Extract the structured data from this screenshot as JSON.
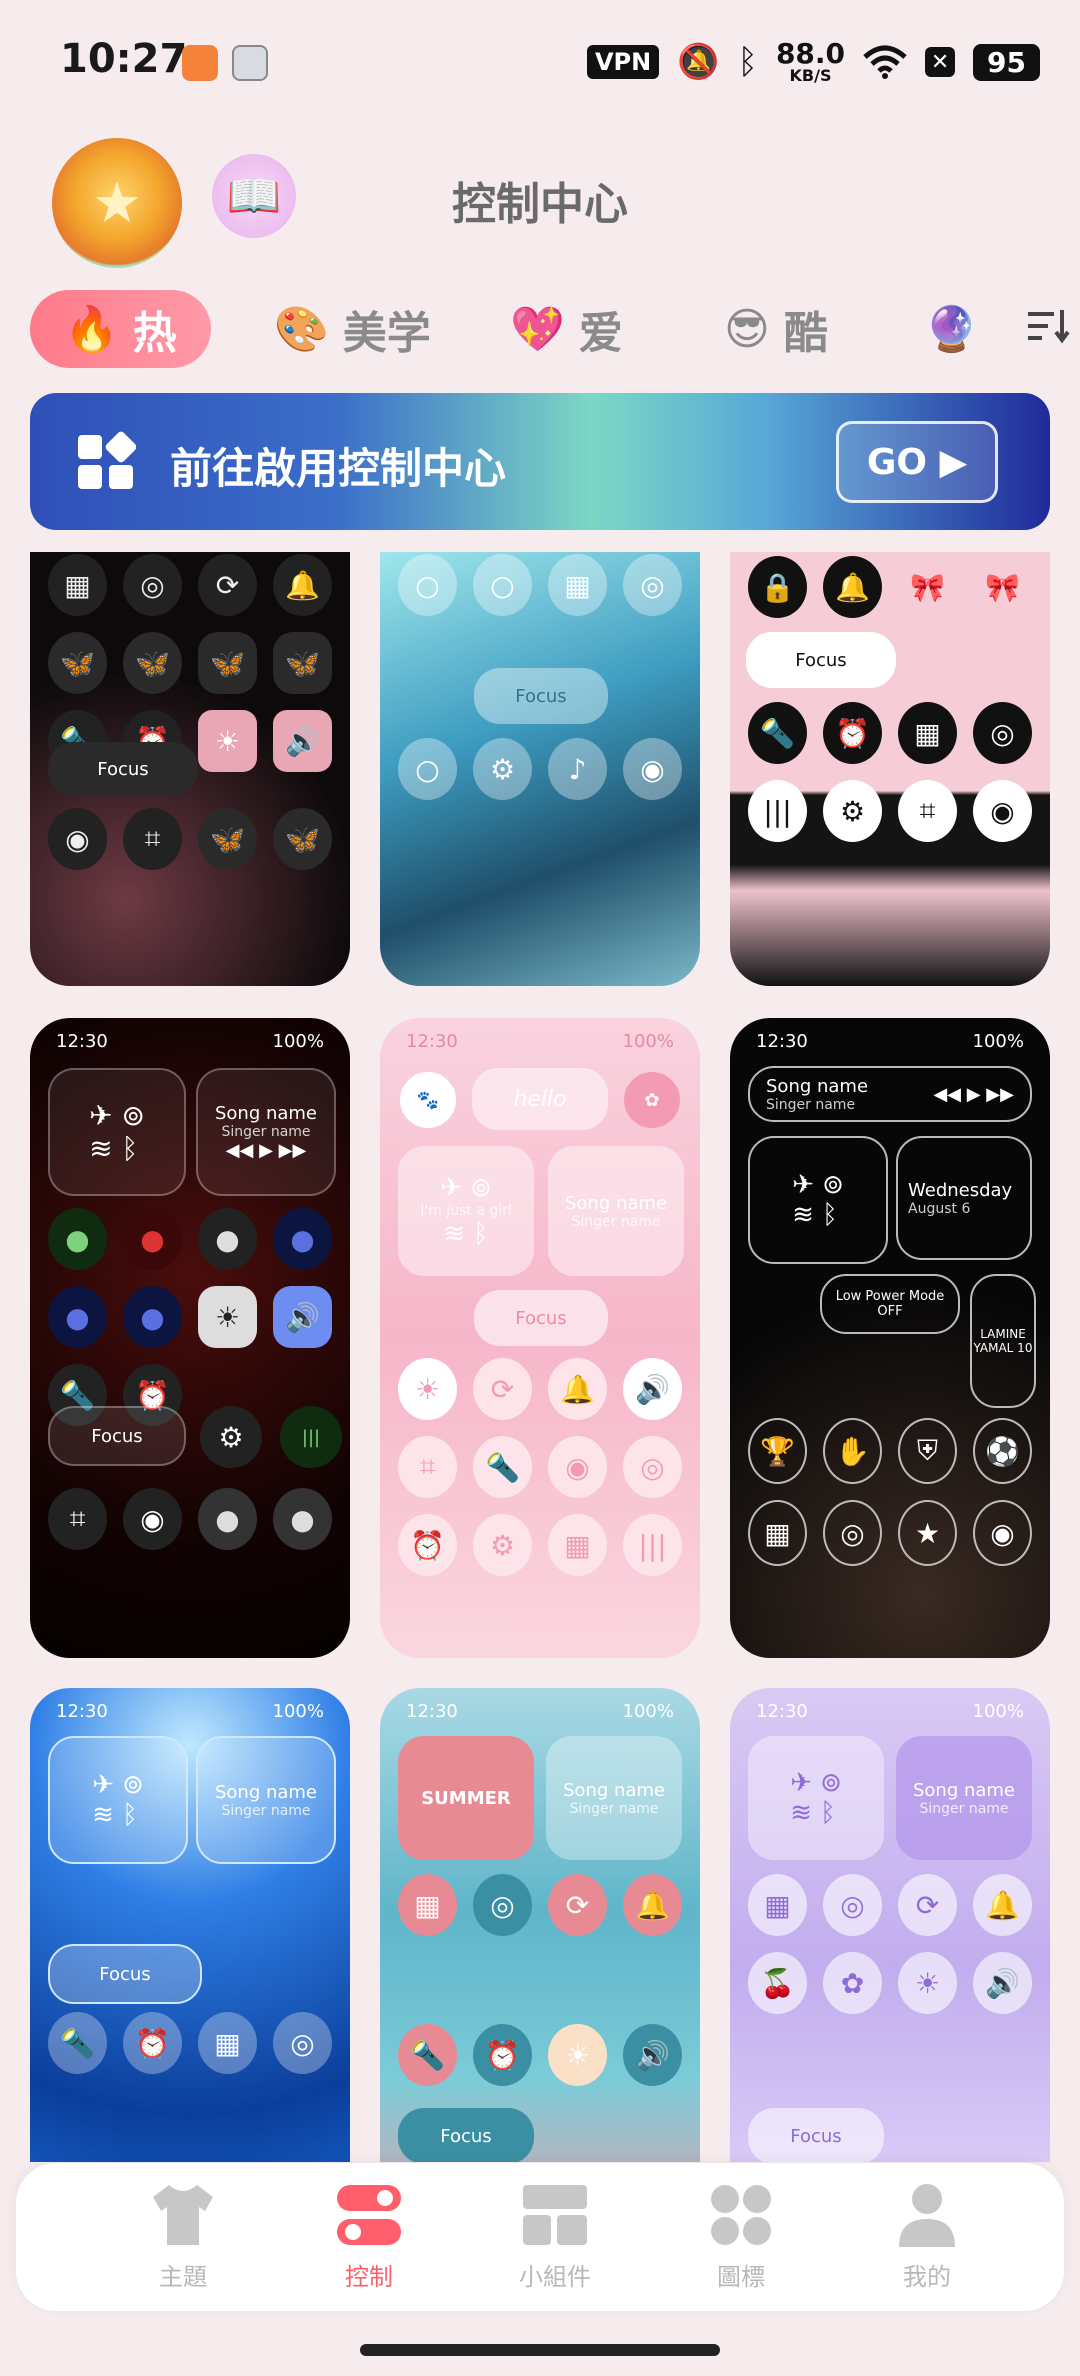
{
  "status_bar": {
    "time": "10:27",
    "vpn": "VPN",
    "net_speed": "88.0",
    "net_unit": "KB/S",
    "battery": "95",
    "icons": [
      "mute-icon",
      "bluetooth-icon",
      "wifi-icon",
      "close-box-icon"
    ]
  },
  "header": {
    "title": "控制中心"
  },
  "tabs": [
    {
      "emoji": "🔥",
      "label": "热",
      "active": true
    },
    {
      "emoji": "🎨",
      "label": "美学"
    },
    {
      "emoji": "💖",
      "label": "爱"
    },
    {
      "emoji": "😎",
      "label": "酷"
    },
    {
      "emoji": "🔮",
      "label": ""
    }
  ],
  "banner": {
    "text": "前往啟用控制中心",
    "button": "GO ▶"
  },
  "themes": [
    {
      "name": "black-pink-butterfly",
      "focus": "Focus",
      "colors": [
        "#0c0c0c",
        "#e9a7b5"
      ]
    },
    {
      "name": "miku-cyan-bubble",
      "focus": "Focus",
      "colors": [
        "#7fd3dc",
        "#3c8bb0"
      ]
    },
    {
      "name": "pink-lace-bow",
      "focus": "Focus",
      "colors": [
        "#f5c9d3",
        "#111111"
      ]
    },
    {
      "name": "red-meme-dark",
      "time": "12:30",
      "battery": "100%",
      "song": "Song name",
      "singer": "Singer name",
      "focus": "Focus",
      "colors": [
        "#2a0606",
        "#b01818"
      ]
    },
    {
      "name": "pink-hello-butterfly",
      "time": "12:30",
      "battery": "100%",
      "song": "Song name",
      "singer": "Singer name",
      "hello": "hello",
      "text": "I'm just a girl",
      "focus": "Focus",
      "colors": [
        "#f7c6d6",
        "#f39bb4"
      ]
    },
    {
      "name": "black-silver-football",
      "time": "12:30",
      "battery": "100%",
      "song": "Song name",
      "singer": "Singer name",
      "day": "Wednesday",
      "date": "August 6",
      "low_power": "Low Power Mode OFF",
      "jersey": "LAMINE YAMAL 10",
      "colors": [
        "#060606",
        "#c8c8c8"
      ]
    },
    {
      "name": "blue-ocean-glitter",
      "time": "12:30",
      "battery": "100%",
      "song": "Song name",
      "singer": "Singer name",
      "focus": "Focus",
      "colors": [
        "#0a4aa8",
        "#5cb8ff"
      ]
    },
    {
      "name": "summer-pool",
      "time": "12:30",
      "battery": "100%",
      "song": "Song name",
      "singer": "Singer name",
      "summer": "SUMMER",
      "focus": "Focus",
      "colors": [
        "#7fc3d6",
        "#e88a94"
      ]
    },
    {
      "name": "lavender-cherry",
      "time": "12:30",
      "battery": "100%",
      "song": "Song name",
      "singer": "Singer name",
      "focus": "Focus",
      "colors": [
        "#c7b5ee",
        "#8f6ad8"
      ]
    }
  ],
  "bottom_nav": [
    {
      "label": "主題",
      "icon": "shirt-icon"
    },
    {
      "label": "控制",
      "icon": "toggle-icon",
      "active": true
    },
    {
      "label": "小組件",
      "icon": "widget-icon"
    },
    {
      "label": "圖標",
      "icon": "apps-icon"
    },
    {
      "label": "我的",
      "icon": "person-icon"
    }
  ],
  "accent": "#ff6f7d"
}
